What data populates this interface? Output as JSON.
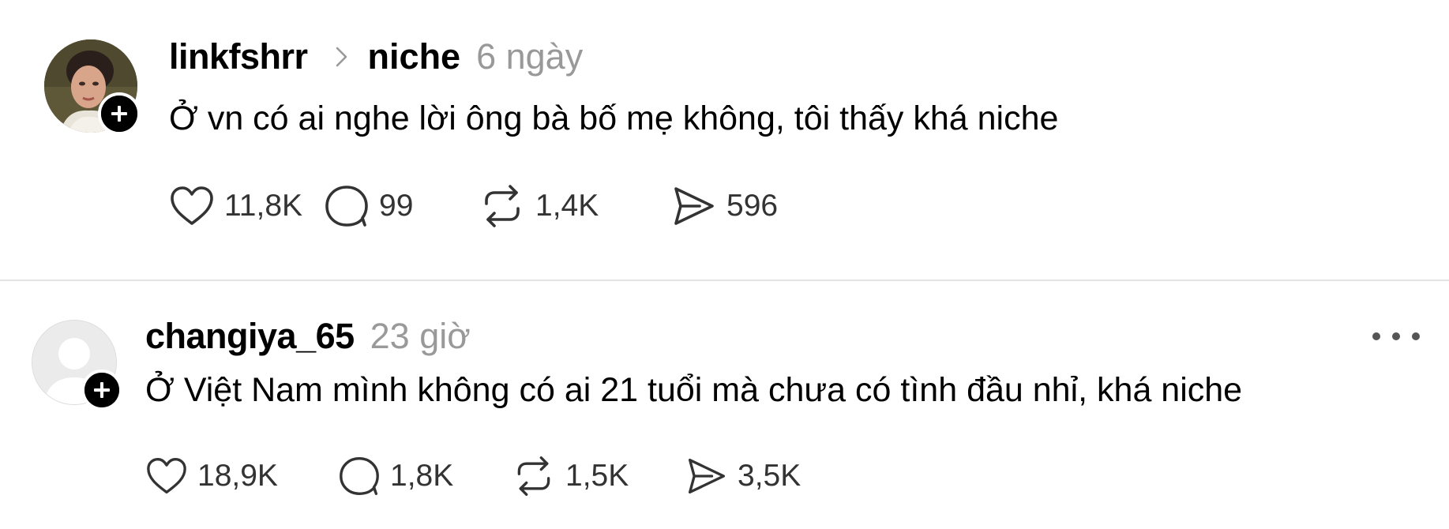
{
  "posts": [
    {
      "username": "linkfshrr",
      "topic": "niche",
      "timestamp": "6 ngày",
      "text": "Ở vn có ai nghe lời ông bà bố mẹ không, tôi thấy khá niche",
      "likes": "11,8K",
      "comments": "99",
      "reposts": "1,4K",
      "shares": "596"
    },
    {
      "username": "changiya_65",
      "timestamp": "23 giờ",
      "text": "Ở Việt Nam mình không có ai 21 tuổi mà chưa có tình đầu nhỉ, khá niche",
      "likes": "18,9K",
      "comments": "1,8K",
      "reposts": "1,5K",
      "shares": "3,5K"
    }
  ],
  "icons": {
    "like": "heart-icon",
    "comment": "comment-bubble-icon",
    "repost": "repost-icon",
    "share": "send-icon",
    "follow": "plus-icon",
    "more": "ellipsis-icon",
    "topic_separator": "chevron-right-icon"
  },
  "colors": {
    "text": "#000000",
    "muted": "#999999",
    "divider": "#e3e3e3",
    "badge": "#000000"
  }
}
